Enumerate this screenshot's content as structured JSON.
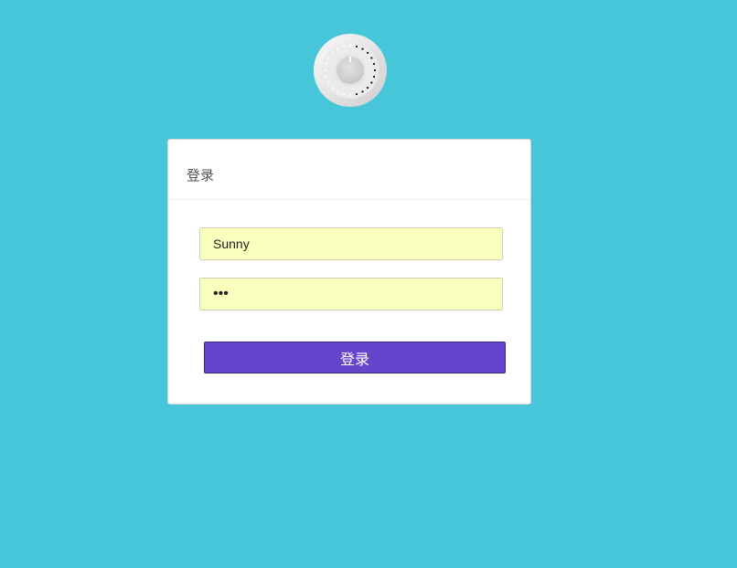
{
  "login": {
    "title": "登录",
    "username_value": "Sunny",
    "password_value": "abc",
    "submit_label": "登录"
  },
  "icons": {
    "logo": "dial-lock-icon"
  },
  "colors": {
    "background": "#47c6da",
    "button": "#6644cc",
    "input_fill": "#faffbd"
  }
}
